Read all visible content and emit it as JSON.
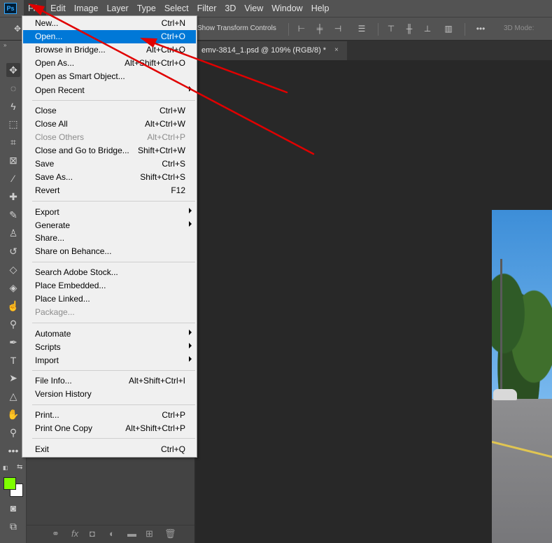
{
  "app": {
    "logo_text": "Ps"
  },
  "menubar": {
    "items": [
      "File",
      "Edit",
      "Image",
      "Layer",
      "Type",
      "Select",
      "Filter",
      "3D",
      "View",
      "Window",
      "Help"
    ]
  },
  "options_bar": {
    "show_transform_controls": "Show Transform Controls",
    "more_label": "•••",
    "three_d_mode": "3D Mode:"
  },
  "toolbar": {
    "collapse_label": "»",
    "more_label": "•••",
    "foreground_color": "#7fff00",
    "background_color": "#ffffff"
  },
  "document": {
    "tab_title": "emv-3814_1.psd @ 109% (RGB/8) *",
    "close_label": "×"
  },
  "file_menu": {
    "items": [
      {
        "label": "New...",
        "shortcut": "Ctrl+N"
      },
      {
        "label": "Open...",
        "shortcut": "Ctrl+O",
        "highlighted": true
      },
      {
        "label": "Browse in Bridge...",
        "shortcut": "Alt+Ctrl+O"
      },
      {
        "label": "Open As...",
        "shortcut": "Alt+Shift+Ctrl+O"
      },
      {
        "label": "Open as Smart Object...",
        "shortcut": ""
      },
      {
        "label": "Open Recent",
        "shortcut": "",
        "submenu": true
      },
      {
        "label": "Close",
        "shortcut": "Ctrl+W"
      },
      {
        "label": "Close All",
        "shortcut": "Alt+Ctrl+W"
      },
      {
        "label": "Close Others",
        "shortcut": "Alt+Ctrl+P",
        "disabled": true
      },
      {
        "label": "Close and Go to Bridge...",
        "shortcut": "Shift+Ctrl+W"
      },
      {
        "label": "Save",
        "shortcut": "Ctrl+S"
      },
      {
        "label": "Save As...",
        "shortcut": "Shift+Ctrl+S"
      },
      {
        "label": "Revert",
        "shortcut": "F12"
      },
      {
        "label": "Export",
        "shortcut": "",
        "submenu": true
      },
      {
        "label": "Generate",
        "shortcut": "",
        "submenu": true
      },
      {
        "label": "Share...",
        "shortcut": ""
      },
      {
        "label": "Share on Behance...",
        "shortcut": ""
      },
      {
        "label": "Search Adobe Stock...",
        "shortcut": ""
      },
      {
        "label": "Place Embedded...",
        "shortcut": ""
      },
      {
        "label": "Place Linked...",
        "shortcut": ""
      },
      {
        "label": "Package...",
        "shortcut": "",
        "disabled": true
      },
      {
        "label": "Automate",
        "shortcut": "",
        "submenu": true
      },
      {
        "label": "Scripts",
        "shortcut": "",
        "submenu": true
      },
      {
        "label": "Import",
        "shortcut": "",
        "submenu": true
      },
      {
        "label": "File Info...",
        "shortcut": "Alt+Shift+Ctrl+I"
      },
      {
        "label": "Version History",
        "shortcut": ""
      },
      {
        "label": "Print...",
        "shortcut": "Ctrl+P"
      },
      {
        "label": "Print One Copy",
        "shortcut": "Alt+Shift+Ctrl+P"
      },
      {
        "label": "Exit",
        "shortcut": "Ctrl+Q"
      }
    ]
  },
  "colors": {
    "menu_highlight": "#0078d7",
    "annotation_arrow": "#e00000"
  }
}
